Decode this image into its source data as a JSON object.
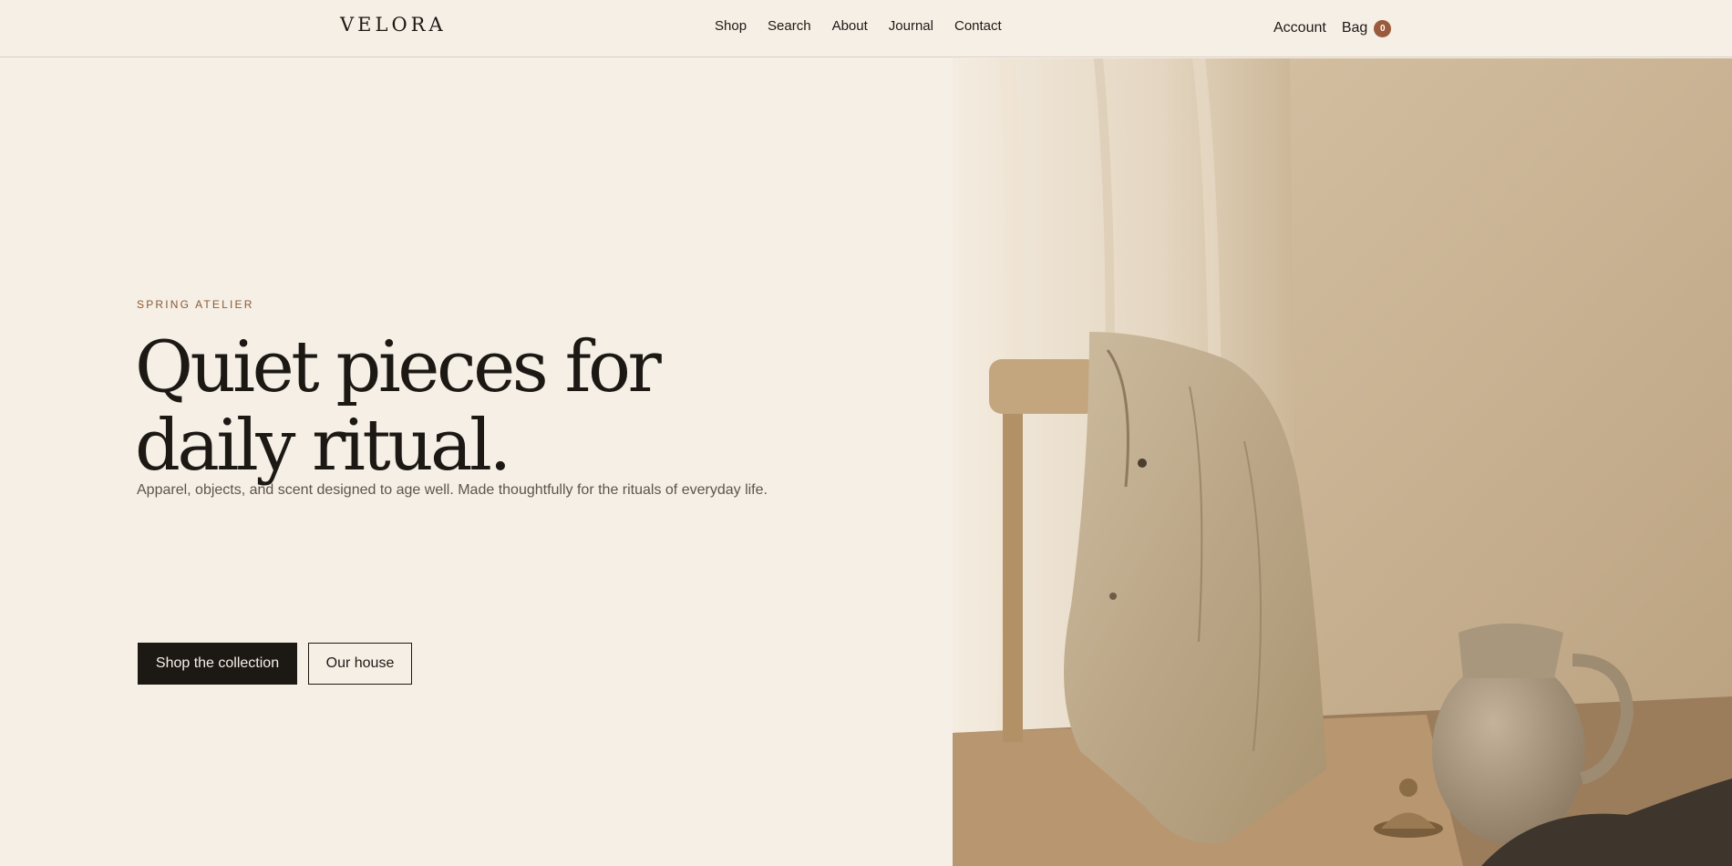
{
  "header": {
    "logo": "VELORA",
    "nav": [
      {
        "label": "Shop"
      },
      {
        "label": "Search"
      },
      {
        "label": "About"
      },
      {
        "label": "Journal"
      },
      {
        "label": "Contact"
      }
    ],
    "account_label": "Account",
    "bag_label": "Bag",
    "bag_count": "0"
  },
  "hero": {
    "eyebrow": "SPRING ATELIER",
    "headline_line1": "Quiet pieces for",
    "headline_line2": "daily ritual.",
    "subtitle": "Apparel, objects, and scent designed to age well. Made thoughtfully for the rituals of everyday life.",
    "primary_button": "Shop the collection",
    "secondary_button": "Our house"
  },
  "colors": {
    "background": "#f6efe6",
    "text": "#1c1915",
    "accent": "#9a5a3c",
    "eyebrow": "#8a5a32"
  }
}
